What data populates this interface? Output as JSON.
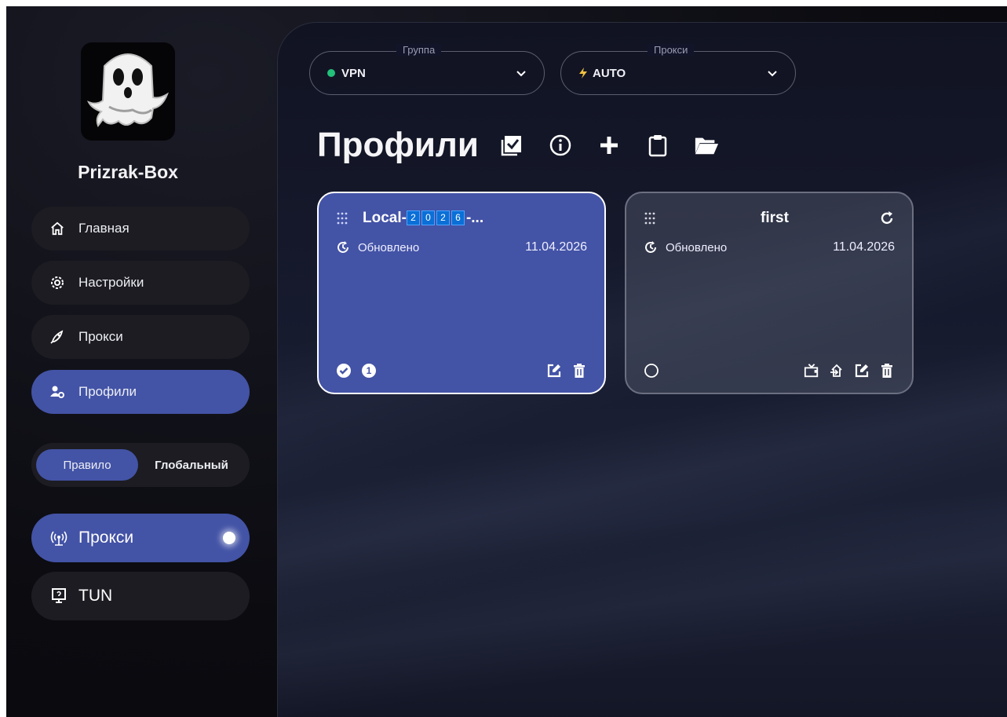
{
  "app": {
    "name": "Prizrak-Box"
  },
  "sidebar": {
    "items": [
      {
        "label": "Главная",
        "icon": "home-icon"
      },
      {
        "label": "Настройки",
        "icon": "gear-icon"
      },
      {
        "label": "Прокси",
        "icon": "rocket-icon"
      },
      {
        "label": "Профили",
        "icon": "users-gear-icon",
        "active": true
      }
    ],
    "mode": {
      "options": [
        "Правило",
        "Глобальный"
      ],
      "selected": "Правило"
    },
    "proxy_toggle": {
      "label": "Прокси",
      "icon": "broadcast-icon",
      "on": true
    },
    "tun_toggle": {
      "label": "TUN",
      "icon": "monitor-question-icon",
      "on": false
    }
  },
  "header": {
    "group_select": {
      "label": "Группа",
      "value": "VPN",
      "status_color": "#22c07a"
    },
    "proxy_select": {
      "label": "Прокси",
      "value": "AUTO",
      "icon": "lightning-icon",
      "icon_color": "#f0c040"
    }
  },
  "page": {
    "title": "Профили"
  },
  "profiles": [
    {
      "title_prefix": "Local-",
      "title_chips": [
        "2",
        "0",
        "2",
        "6"
      ],
      "title_suffix": "-...",
      "updated_label": "Обновлено",
      "updated_date": "11.04.2026",
      "selected": true,
      "badge": "1"
    },
    {
      "title": "first",
      "updated_label": "Обновлено",
      "updated_date": "11.04.2026",
      "selected": false
    }
  ],
  "colors": {
    "accent": "#4353a6",
    "chip": "#0a6fd6"
  }
}
